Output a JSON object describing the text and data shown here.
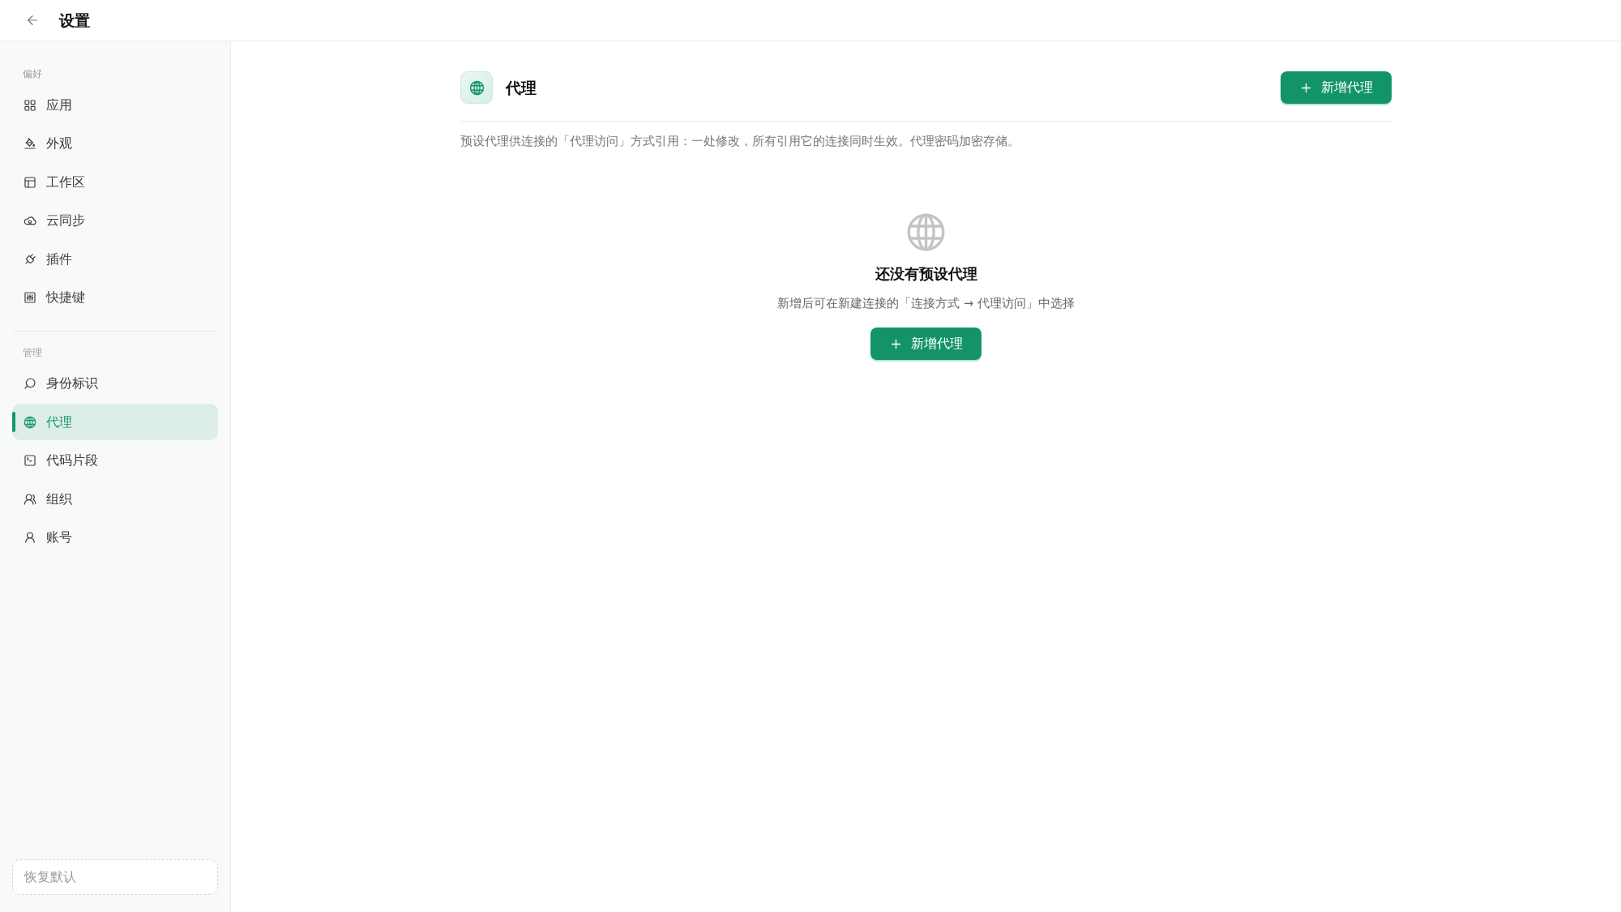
{
  "top_bar": {
    "title": "设置"
  },
  "sidebar": {
    "sections": [
      {
        "label": "偏好",
        "items": [
          {
            "label": "应用",
            "selected": false
          },
          {
            "label": "外观",
            "selected": false
          },
          {
            "label": "工作区",
            "selected": false
          },
          {
            "label": "云同步",
            "selected": false
          },
          {
            "label": "插件",
            "selected": false
          },
          {
            "label": "快捷键",
            "selected": false
          }
        ]
      },
      {
        "label": "管理",
        "items": [
          {
            "label": "身份标识",
            "selected": false
          },
          {
            "label": "代理",
            "selected": true
          },
          {
            "label": "代码片段",
            "selected": false
          },
          {
            "label": "组织",
            "selected": false
          },
          {
            "label": "账号",
            "selected": false
          }
        ]
      }
    ],
    "reset_button": "恢复默认"
  },
  "page": {
    "title": "代理",
    "add_button": "新增代理",
    "description": "预设代理供连接的「代理访问」方式引用：一处修改，所有引用它的连接同时生效。代理密码加密存储。",
    "empty_state": {
      "title": "还没有预设代理",
      "hint": "新增后可在新建连接的「连接方式 → 代理访问」中选择",
      "button": "新增代理"
    }
  }
}
